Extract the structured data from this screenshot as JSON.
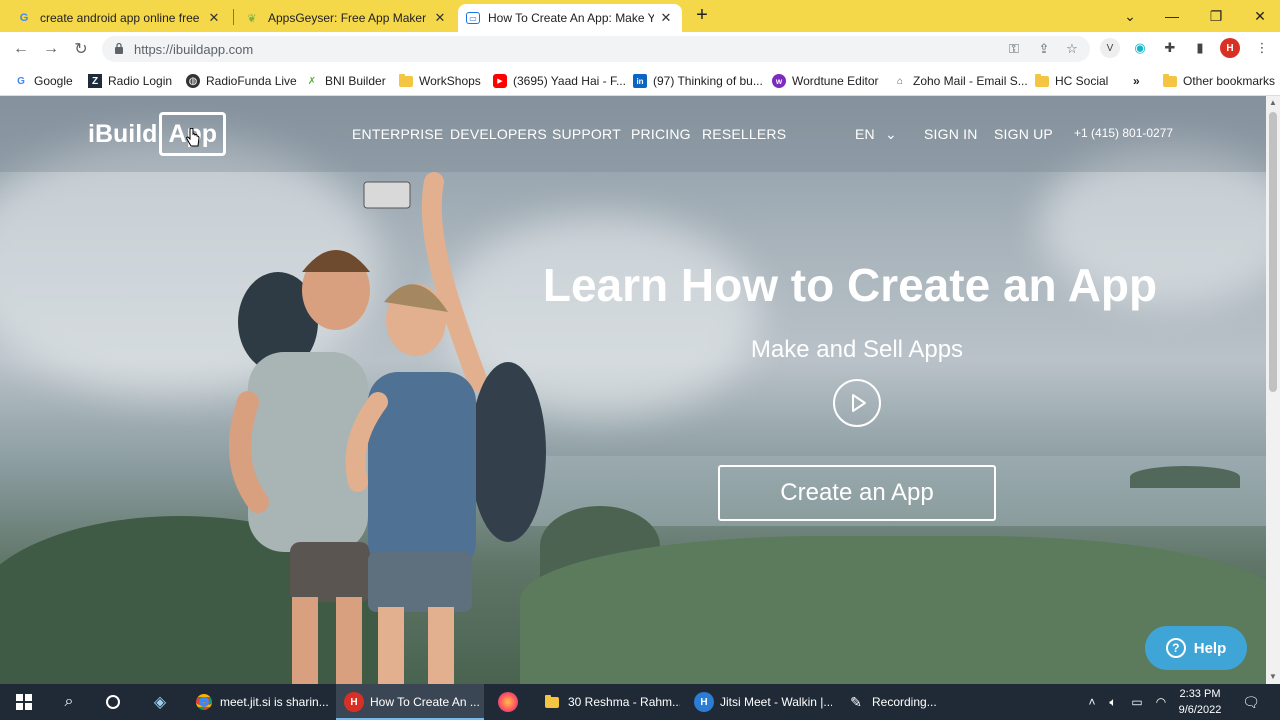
{
  "browser": {
    "tabs": [
      {
        "title": "create android app online free - G",
        "favicon": "google-icon"
      },
      {
        "title": "AppsGeyser: Free App Maker | Cre",
        "favicon": "appsgeyser-icon"
      },
      {
        "title": "How To Create An App: Make Yo",
        "favicon": "ibuildapp-icon"
      }
    ],
    "url": "https://ibuildapp.com",
    "bookmarks": [
      {
        "label": "Google",
        "icon": "google-icon"
      },
      {
        "label": "Radio Login",
        "icon": "radio-icon"
      },
      {
        "label": "RadioFunda Live",
        "icon": "globe-icon"
      },
      {
        "label": "BNI Builder",
        "icon": "bni-icon"
      },
      {
        "label": "WorkShops",
        "icon": "folder-icon"
      },
      {
        "label": "(3695) Yaad Hai - F...",
        "icon": "youtube-icon"
      },
      {
        "label": "(97) Thinking of bu...",
        "icon": "linkedin-icon"
      },
      {
        "label": "Wordtune Editor",
        "icon": "wordtune-icon"
      },
      {
        "label": "Zoho Mail - Email S...",
        "icon": "zoho-icon"
      },
      {
        "label": "HC Social",
        "icon": "folder-icon"
      },
      {
        "label": "Other bookmarks",
        "icon": "folder-icon"
      }
    ],
    "more_bookmarks": "»"
  },
  "site": {
    "logo_left": "iBuild",
    "logo_right": "App",
    "nav": [
      "ENTERPRISE",
      "DEVELOPERS",
      "SUPPORT",
      "PRICING",
      "RESELLERS"
    ],
    "language": "EN",
    "sign_in": "SIGN IN",
    "sign_up": "SIGN UP",
    "phone": "+1 (415) 801-0277",
    "hero_title": "Learn How to Create an App",
    "hero_subtitle": "Make and Sell Apps",
    "cta_label": "Create an App",
    "help_label": "Help"
  },
  "taskbar": {
    "apps": [
      {
        "label": "meet.jit.si is sharin...",
        "icon": "chrome-icon"
      },
      {
        "label": "How To Create An ...",
        "icon": "chrome-profile-icon"
      },
      {
        "label": "",
        "icon": "firefox-icon"
      },
      {
        "label": "30 Reshma - Rahm...",
        "icon": "folder-icon"
      },
      {
        "label": "Jitsi Meet - Walkin |...",
        "icon": "edge-profile-icon"
      },
      {
        "label": "Recording...",
        "icon": "recorder-icon"
      }
    ],
    "time": "2:33 PM",
    "date": "9/6/2022"
  },
  "colors": {
    "tab_strip": "#f5d84a",
    "help_button": "#3fa5d6",
    "taskbar": "#1f2a36"
  }
}
